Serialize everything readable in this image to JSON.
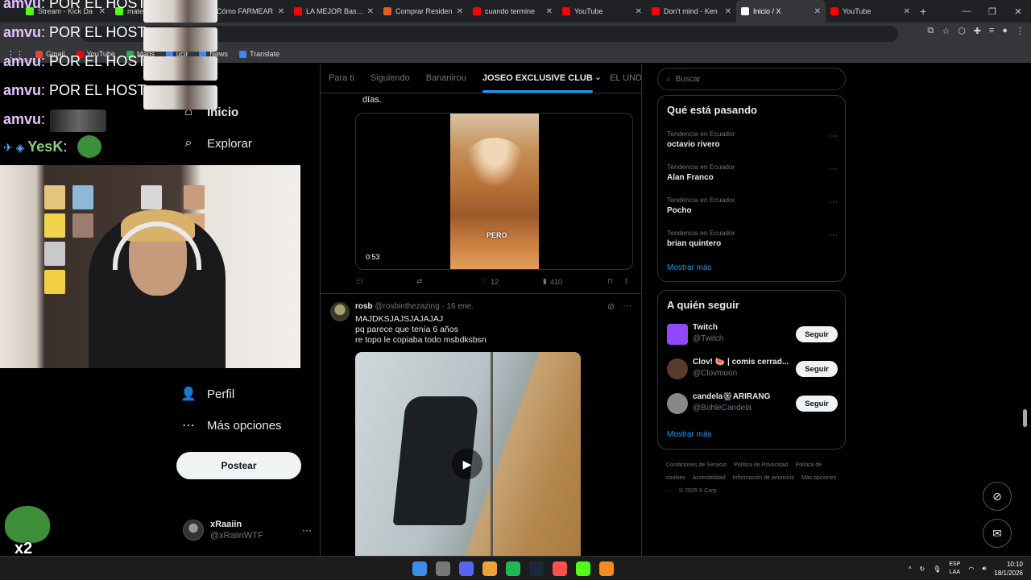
{
  "browser": {
    "tabs": [
      {
        "title": "Stream - Kick Da",
        "color": "#53fc18"
      },
      {
        "title": "mate",
        "color": "#53fc18"
      },
      {
        "title": "Cómo FARMEAR",
        "color": "#ff0000"
      },
      {
        "title": "LA MEJOR Base C",
        "color": "#ff0000"
      },
      {
        "title": "Comprar Residen",
        "color": "#e85d25"
      },
      {
        "title": "cuando termine",
        "color": "#ff0000"
      },
      {
        "title": "YouTube",
        "color": "#ff0000"
      },
      {
        "title": "Don't mind - Ken",
        "color": "#ff0000"
      },
      {
        "title": "Inicio / X",
        "color": "#ffffff",
        "active": true
      },
      {
        "title": "YouTube",
        "color": "#ff0000"
      }
    ],
    "bookmarks": [
      {
        "label": "Gmail",
        "color": "#ea4335"
      },
      {
        "label": "YouTube",
        "color": "#ff0000"
      },
      {
        "label": "Maps",
        "color": "#34a853"
      },
      {
        "label": "ucir",
        "color": "#4285f4"
      },
      {
        "label": "News",
        "color": "#4285f4"
      },
      {
        "label": "Translate",
        "color": "#4285f4"
      }
    ]
  },
  "nav": {
    "home": "Inicio",
    "explore": "Explorar",
    "profile": "Perfil",
    "more": "Más opciones",
    "post": "Postear"
  },
  "account": {
    "name": "xRaaiin",
    "handle": "@xRaiinWTF"
  },
  "feed": {
    "tabs": [
      "Para ti",
      "Siguiendo",
      "Bananirou",
      "JOSEO EXCLUSIVE CLUB",
      "EL UNDER"
    ],
    "active_tab": "JOSEO EXCLUSIVE CLUB",
    "tweet1": {
      "text_tail": "días.",
      "video_caption": "PERO",
      "duration": "0:53",
      "retweets": "",
      "likes": "12",
      "views": "410"
    },
    "tweet2": {
      "name": "rosb",
      "handle": "@rosbinthezazing",
      "date": "· 16 ene.",
      "line1": "MAJDKSJAJSJAJAJAJ",
      "line2": "pq parece que tenía 6 años",
      "line3": "re topo le copiaba todo msbdksbsn"
    }
  },
  "sidebar": {
    "search_placeholder": "Buscar",
    "trends_title": "Qué está pasando",
    "trends": [
      {
        "context": "Tendencia en Ecuador",
        "name": "octavio rivero"
      },
      {
        "context": "Tendencia en Ecuador",
        "name": "Alan Franco"
      },
      {
        "context": "Tendencia en Ecuador",
        "name": "Pocho"
      },
      {
        "context": "Tendencia en Ecuador",
        "name": "brian quintero"
      }
    ],
    "show_more": "Mostrar más",
    "follow_title": "A quién seguir",
    "follow": [
      {
        "name": "Twitch",
        "handle": "@Twitch",
        "color": "#9146ff"
      },
      {
        "name": "Clov! 🍉 | comis cerrad...",
        "handle": "@Clovmoon",
        "color": "#5a3a2a"
      },
      {
        "name": "candela🎡ARIRANG",
        "handle": "@BohleCandela",
        "color": "#888888"
      }
    ],
    "follow_button": "Seguir",
    "footer": [
      "Condiciones de Servicio",
      "Política de Privacidad",
      "Política de cookies",
      "Accesibilidad",
      "Información de anuncios",
      "Más opciones ···",
      "© 2026 X Corp."
    ]
  },
  "overlay": {
    "chat": [
      {
        "user": "amvu",
        "msg": ": POR EL HOST"
      },
      {
        "user": "amvu",
        "msg": ": POR EL HOST"
      },
      {
        "user": "amvu",
        "msg": ": POR EL HOST"
      },
      {
        "user": "amvu",
        "msg": ": POR EL HOST"
      },
      {
        "user": "amvu",
        "msg": ":"
      },
      {
        "user": "YesK",
        "msg": ":"
      }
    ],
    "emote_multiplier": "x2"
  },
  "taskbar": {
    "lang_top": "ESP",
    "lang_bottom": "LAA",
    "time": "10:10",
    "date": "18/1/2026"
  }
}
